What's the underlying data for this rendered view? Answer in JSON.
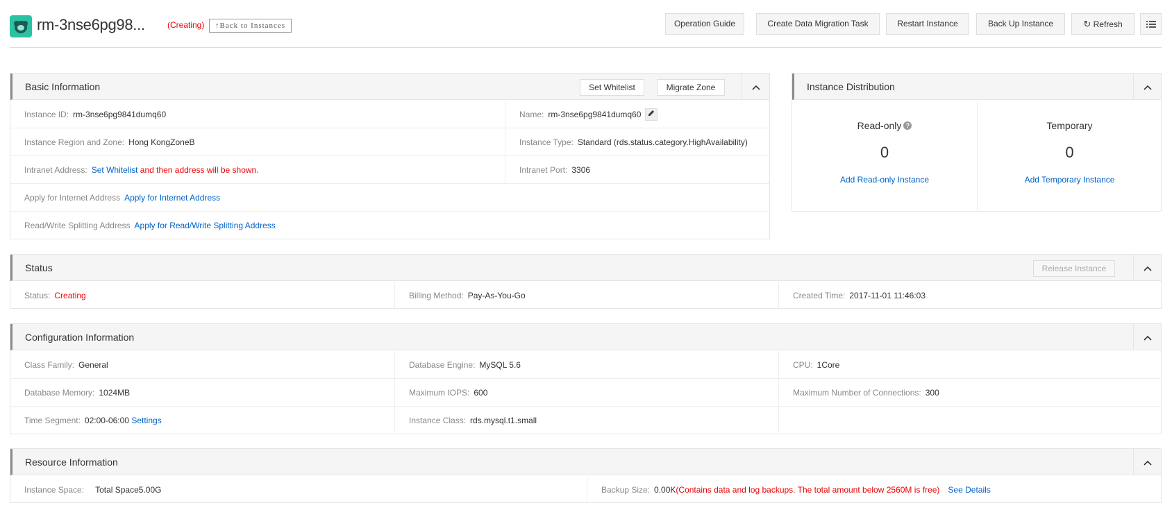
{
  "header": {
    "title": "rm-3nse6pg98...",
    "status_tag": "(Creating)",
    "back_label": "↑Back to Instances",
    "buttons": {
      "operation_guide": "Operation Guide",
      "create_migration": "Create Data Migration Task",
      "restart": "Restart Instance",
      "backup": "Back Up Instance",
      "refresh": "Refresh"
    }
  },
  "basic": {
    "title": "Basic Information",
    "set_whitelist_btn": "Set Whitelist",
    "migrate_zone_btn": "Migrate Zone",
    "instance_id_label": "Instance ID:",
    "instance_id": "rm-3nse6pg9841dumq60",
    "name_label": "Name:",
    "name": "rm-3nse6pg9841dumq60",
    "region_label": "Instance Region and Zone:",
    "region": "Hong KongZoneB",
    "type_label": "Instance Type:",
    "type": "Standard (rds.status.category.HighAvailability)",
    "intranet_label": "Intranet Address:",
    "intranet_link": "Set Whitelist",
    "intranet_note": "and then address will be shown.",
    "port_label": "Intranet Port:",
    "port": "3306",
    "internet_label": "Apply for Internet Address",
    "internet_link": "Apply for Internet Address",
    "rw_label": "Read/Write Splitting Address",
    "rw_link": "Apply for Read/Write Splitting Address"
  },
  "distribution": {
    "title": "Instance Distribution",
    "readonly_label": "Read-only",
    "readonly_count": "0",
    "readonly_link": "Add Read-only Instance",
    "temporary_label": "Temporary",
    "temporary_count": "0",
    "temporary_link": "Add Temporary Instance"
  },
  "status": {
    "title": "Status",
    "release_btn": "Release Instance",
    "status_label": "Status:",
    "status_value": "Creating",
    "billing_label": "Billing Method:",
    "billing_value": "Pay-As-You-Go",
    "created_label": "Created Time:",
    "created_value": "2017-11-01 11:46:03"
  },
  "config": {
    "title": "Configuration Information",
    "class_family_label": "Class Family:",
    "class_family": "General",
    "engine_label": "Database Engine:",
    "engine": "MySQL 5.6",
    "cpu_label": "CPU:",
    "cpu": "1Core",
    "memory_label": "Database Memory:",
    "memory": "1024MB",
    "iops_label": "Maximum IOPS:",
    "iops": "600",
    "connections_label": "Maximum Number of Connections:",
    "connections": "300",
    "segment_label": "Time Segment:",
    "segment": "02:00-06:00",
    "segment_link": "Settings",
    "class_label": "Instance Class:",
    "class": "rds.mysql.t1.small"
  },
  "resource": {
    "title": "Resource Information",
    "space_label": "Instance Space:",
    "space": "Total Space5.00G",
    "backup_label": "Backup Size:",
    "backup": "0.00K",
    "backup_note": "(Contains data and log backups. The total amount below 2560M is free)",
    "details_link": "See Details"
  },
  "colors": {
    "accent": "#0063c6",
    "danger": "#e00000",
    "logo": "#2bc2a3"
  }
}
